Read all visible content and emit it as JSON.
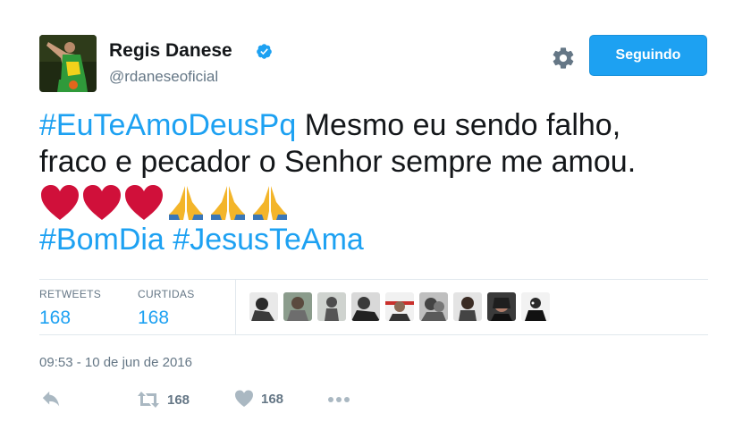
{
  "profile": {
    "name": "Regis Danese",
    "handle": "@rdaneseoficial",
    "verified": true
  },
  "follow_button": {
    "label": "Seguindo"
  },
  "tweet": {
    "line1_hashtag": "#EuTeAmoDeusPq",
    "line1_text": " Mesmo eu sendo falho,",
    "line2_text": "fraco e pecador o Senhor sempre me amou.",
    "emojis": [
      "red-heart",
      "red-heart",
      "red-heart",
      "folded-hands",
      "folded-hands",
      "folded-hands"
    ],
    "hashtag_a": "#BomDia",
    "hashtag_b": "#JesusTeAma"
  },
  "stats": {
    "retweets_label": "RETWEETS",
    "retweets_value": "168",
    "likes_label": "CURTIDAS",
    "likes_value": "168"
  },
  "timestamp": "09:53 - 10 de jun de 2016",
  "actions": {
    "retweet_count": "168",
    "like_count": "168"
  },
  "colors": {
    "accent": "#1da1f2",
    "muted": "#657786",
    "text": "#14171a",
    "divider": "#e1e8ed"
  }
}
